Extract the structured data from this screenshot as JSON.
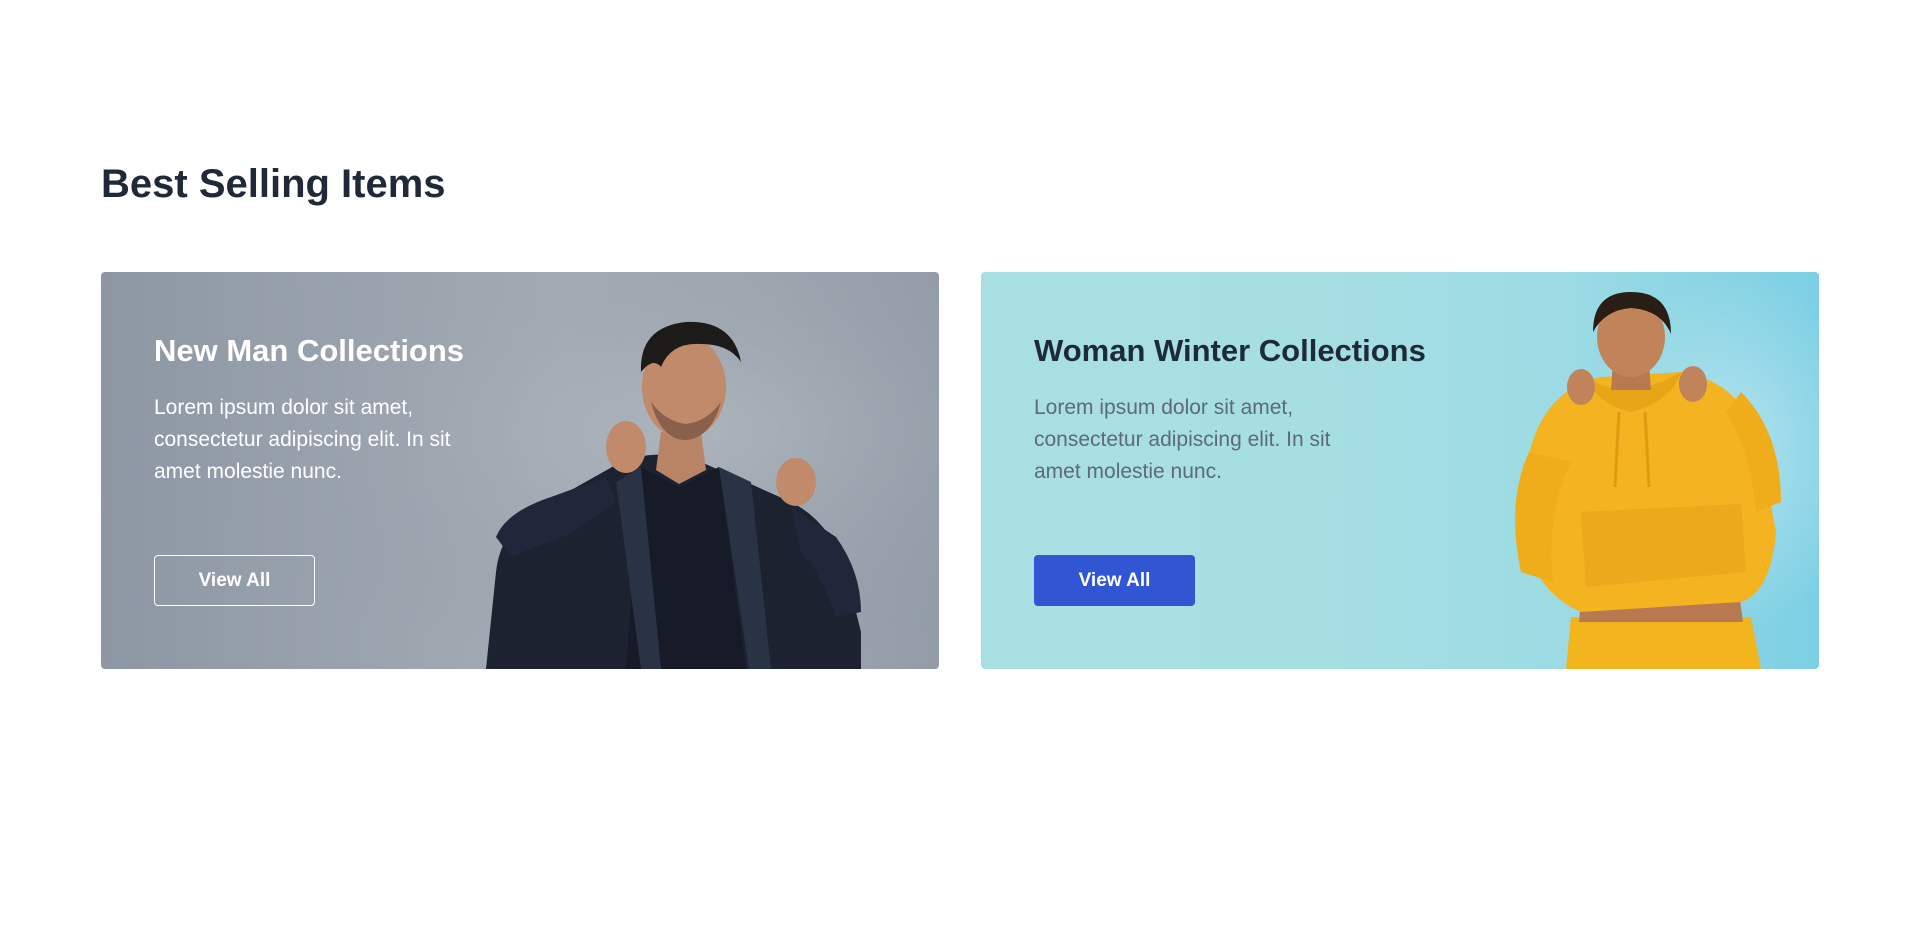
{
  "section": {
    "title": "Best Selling Items"
  },
  "cards": [
    {
      "title": "New Man Collections",
      "description": "Lorem ipsum dolor sit amet, consectetur adipiscing elit. In sit amet molestie nunc.",
      "button_label": "View All",
      "button_style": "outline",
      "colors": {
        "background": "#9aa3ad",
        "text": "#ffffff",
        "button_border": "#ffffff"
      }
    },
    {
      "title": "Woman Winter Collections",
      "description": "Lorem ipsum dolor sit amet, consectetur adipiscing elit. In sit amet molestie nunc.",
      "button_label": "View All",
      "button_style": "filled",
      "colors": {
        "background": "#a6dfe2",
        "title": "#1e2a38",
        "text": "#5e6a76",
        "button": "#3156d3"
      }
    }
  ]
}
